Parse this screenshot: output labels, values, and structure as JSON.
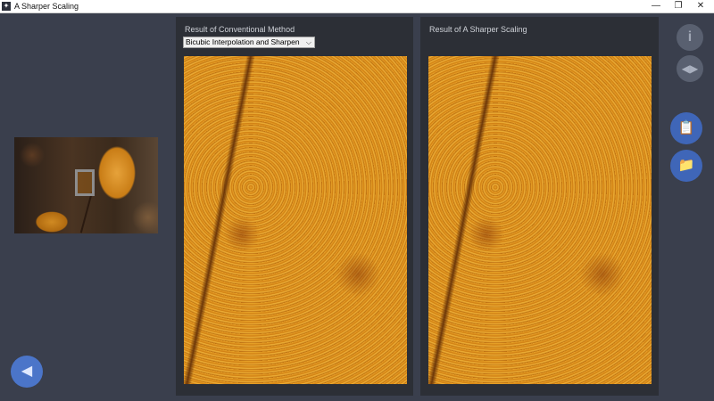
{
  "window": {
    "title": "A Sharper Scaling",
    "app_icon_glyph": "✦",
    "minimize_glyph": "—",
    "maximize_glyph": "❐",
    "close_glyph": "✕"
  },
  "left_panel": {
    "title": "Result of Conventional Method",
    "method_select": {
      "selected": "Bicubic Interpolation and Sharpen",
      "arrow": "⌵"
    }
  },
  "right_panel": {
    "title": "Result of  A Sharper Scaling"
  },
  "side_buttons": {
    "info_glyph": "i",
    "compare_glyph": "◀▶",
    "clipboard_glyph": "📋",
    "folder_glyph": "📁"
  },
  "back_button": {
    "glyph": "◀"
  },
  "colors": {
    "background": "#3a3f4d",
    "panel": "#2c2f36",
    "accent_blue": "#3f66b8",
    "leaf_orange": "#d48916"
  }
}
